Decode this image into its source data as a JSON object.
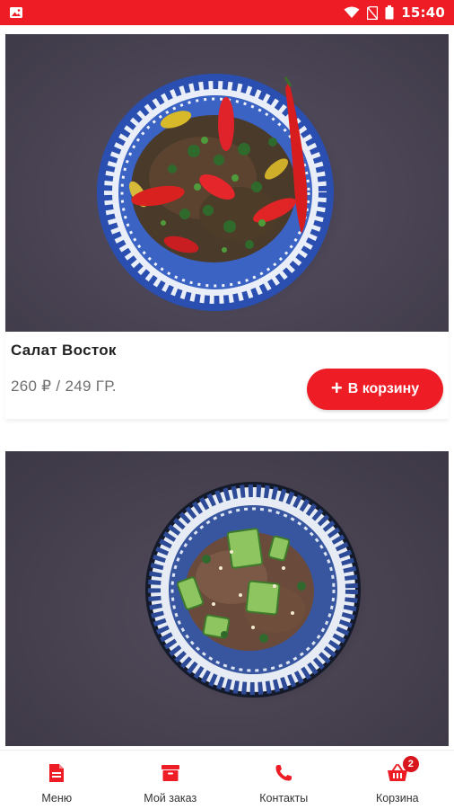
{
  "status_bar": {
    "time": "15:40",
    "icons": [
      "image-icon",
      "wifi-icon",
      "no-sim-icon",
      "battery-icon"
    ]
  },
  "menu_items": [
    {
      "name": "Салат Восток",
      "price": "260 ₽ / 249 ГР.",
      "add_button_label": "В корзину"
    },
    {
      "name": "",
      "price": "",
      "add_button_label": ""
    }
  ],
  "bottom_nav": {
    "menu_label": "Меню",
    "orders_label": "Мой заказ",
    "contacts_label": "Контакты",
    "cart_label": "Корзина",
    "cart_count": "2"
  },
  "colors": {
    "accent": "#ee1c25",
    "badge": "#d8141c"
  }
}
